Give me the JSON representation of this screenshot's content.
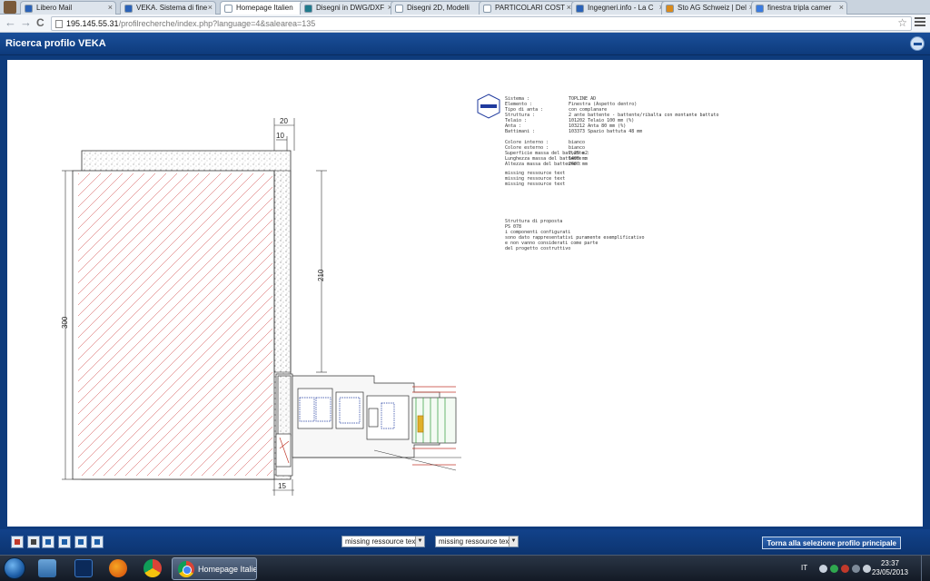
{
  "browser": {
    "tabs": [
      {
        "label": "Libero Mail",
        "color": "#2a62b8"
      },
      {
        "label": "VEKA. Sistema di fine",
        "color": "#2a62b8"
      },
      {
        "label": "Homepage Italien",
        "color": "#ffffff",
        "active": true
      },
      {
        "label": "Disegni in DWG/DXF",
        "color": "#1f7a8c"
      },
      {
        "label": "Disegni 2D, Modelli",
        "color": "#ffffff"
      },
      {
        "label": "PARTICOLARI COST",
        "color": "#ffffff"
      },
      {
        "label": "Ingegneri.info - La C",
        "color": "#2a62b8"
      },
      {
        "label": "Sto AG Schweiz | Del",
        "color": "#d98a1c"
      },
      {
        "label": "finestra tripla camer",
        "color": "#3a7be0"
      }
    ],
    "close_glyph": "×",
    "url_host": "195.145.55.31",
    "url_path": "/profilrecherche/index.php?language=4&salearea=135",
    "star_glyph": "☆",
    "back_glyph": "←",
    "forward_glyph": "→",
    "reload_glyph": "C"
  },
  "app": {
    "title": "Ricerca profilo VEKA",
    "accent": "#0e3b7c"
  },
  "drawing": {
    "dimensions": {
      "top_width": "20",
      "top_small": "10",
      "height_total": "300",
      "height_partial": "210",
      "bottom_small": "15"
    }
  },
  "info": {
    "rows_1": [
      {
        "key": "Sistema :",
        "value": "TOPLINE AD"
      },
      {
        "key": "Elemento :",
        "value": "Finestra (Aspetto dentro)"
      },
      {
        "key": "Tipo di anta :",
        "value": "con complanare"
      },
      {
        "key": "Struttura :",
        "value": "2 ante battente - battente/ribalta con montante battuto"
      },
      {
        "key": "Telaio :",
        "value": "101202 Telaio 100 mm (%)"
      },
      {
        "key": "Anta :",
        "value": "103212 Anta 80 mm (%)"
      },
      {
        "key": "Battimani :",
        "value": "103373 Spazio battuta 48 mm"
      }
    ],
    "rows_2": [
      {
        "key": "Colore interno :",
        "value": "bianco"
      },
      {
        "key": "Colore esterno :",
        "value": "bianco"
      },
      {
        "key": "Superficie massa del battente :",
        "value": "2,25 m2"
      },
      {
        "key": "Lunghezza massa del battente :",
        "value": "1400 mm"
      },
      {
        "key": "Altezza massa del battente :",
        "value": "2400 mm"
      }
    ],
    "missing": [
      "missing ressource text",
      "missing ressource text",
      "missing ressource text"
    ],
    "notes": [
      "Struttura di proposta",
      "PS 078",
      "i componenti configurati",
      "sono dato rappresentativi puramente esemplificativo",
      "e non vanno considerati come parte",
      "del progetto costruttivo"
    ]
  },
  "bottombar": {
    "select_1": "missing ressource text!",
    "select_2": "missing ressource text!",
    "back_button": "Torna alla selezione profilo principale",
    "tools": [
      {
        "icon": "print-icon",
        "color": "#c0392b"
      },
      {
        "icon": "dxf-export-icon",
        "color": "#444444"
      },
      {
        "icon": "zoom-in-icon",
        "color": "#1e5fa8"
      },
      {
        "icon": "zoom-out-icon",
        "color": "#1e5fa8"
      },
      {
        "icon": "pan-icon",
        "color": "#1e5fa8"
      },
      {
        "icon": "fit-icon",
        "color": "#1e5fa8"
      }
    ]
  },
  "taskbar": {
    "active_window": "Homepage Italien...",
    "language": "IT",
    "time": "23:37",
    "date": "23/05/2013"
  }
}
